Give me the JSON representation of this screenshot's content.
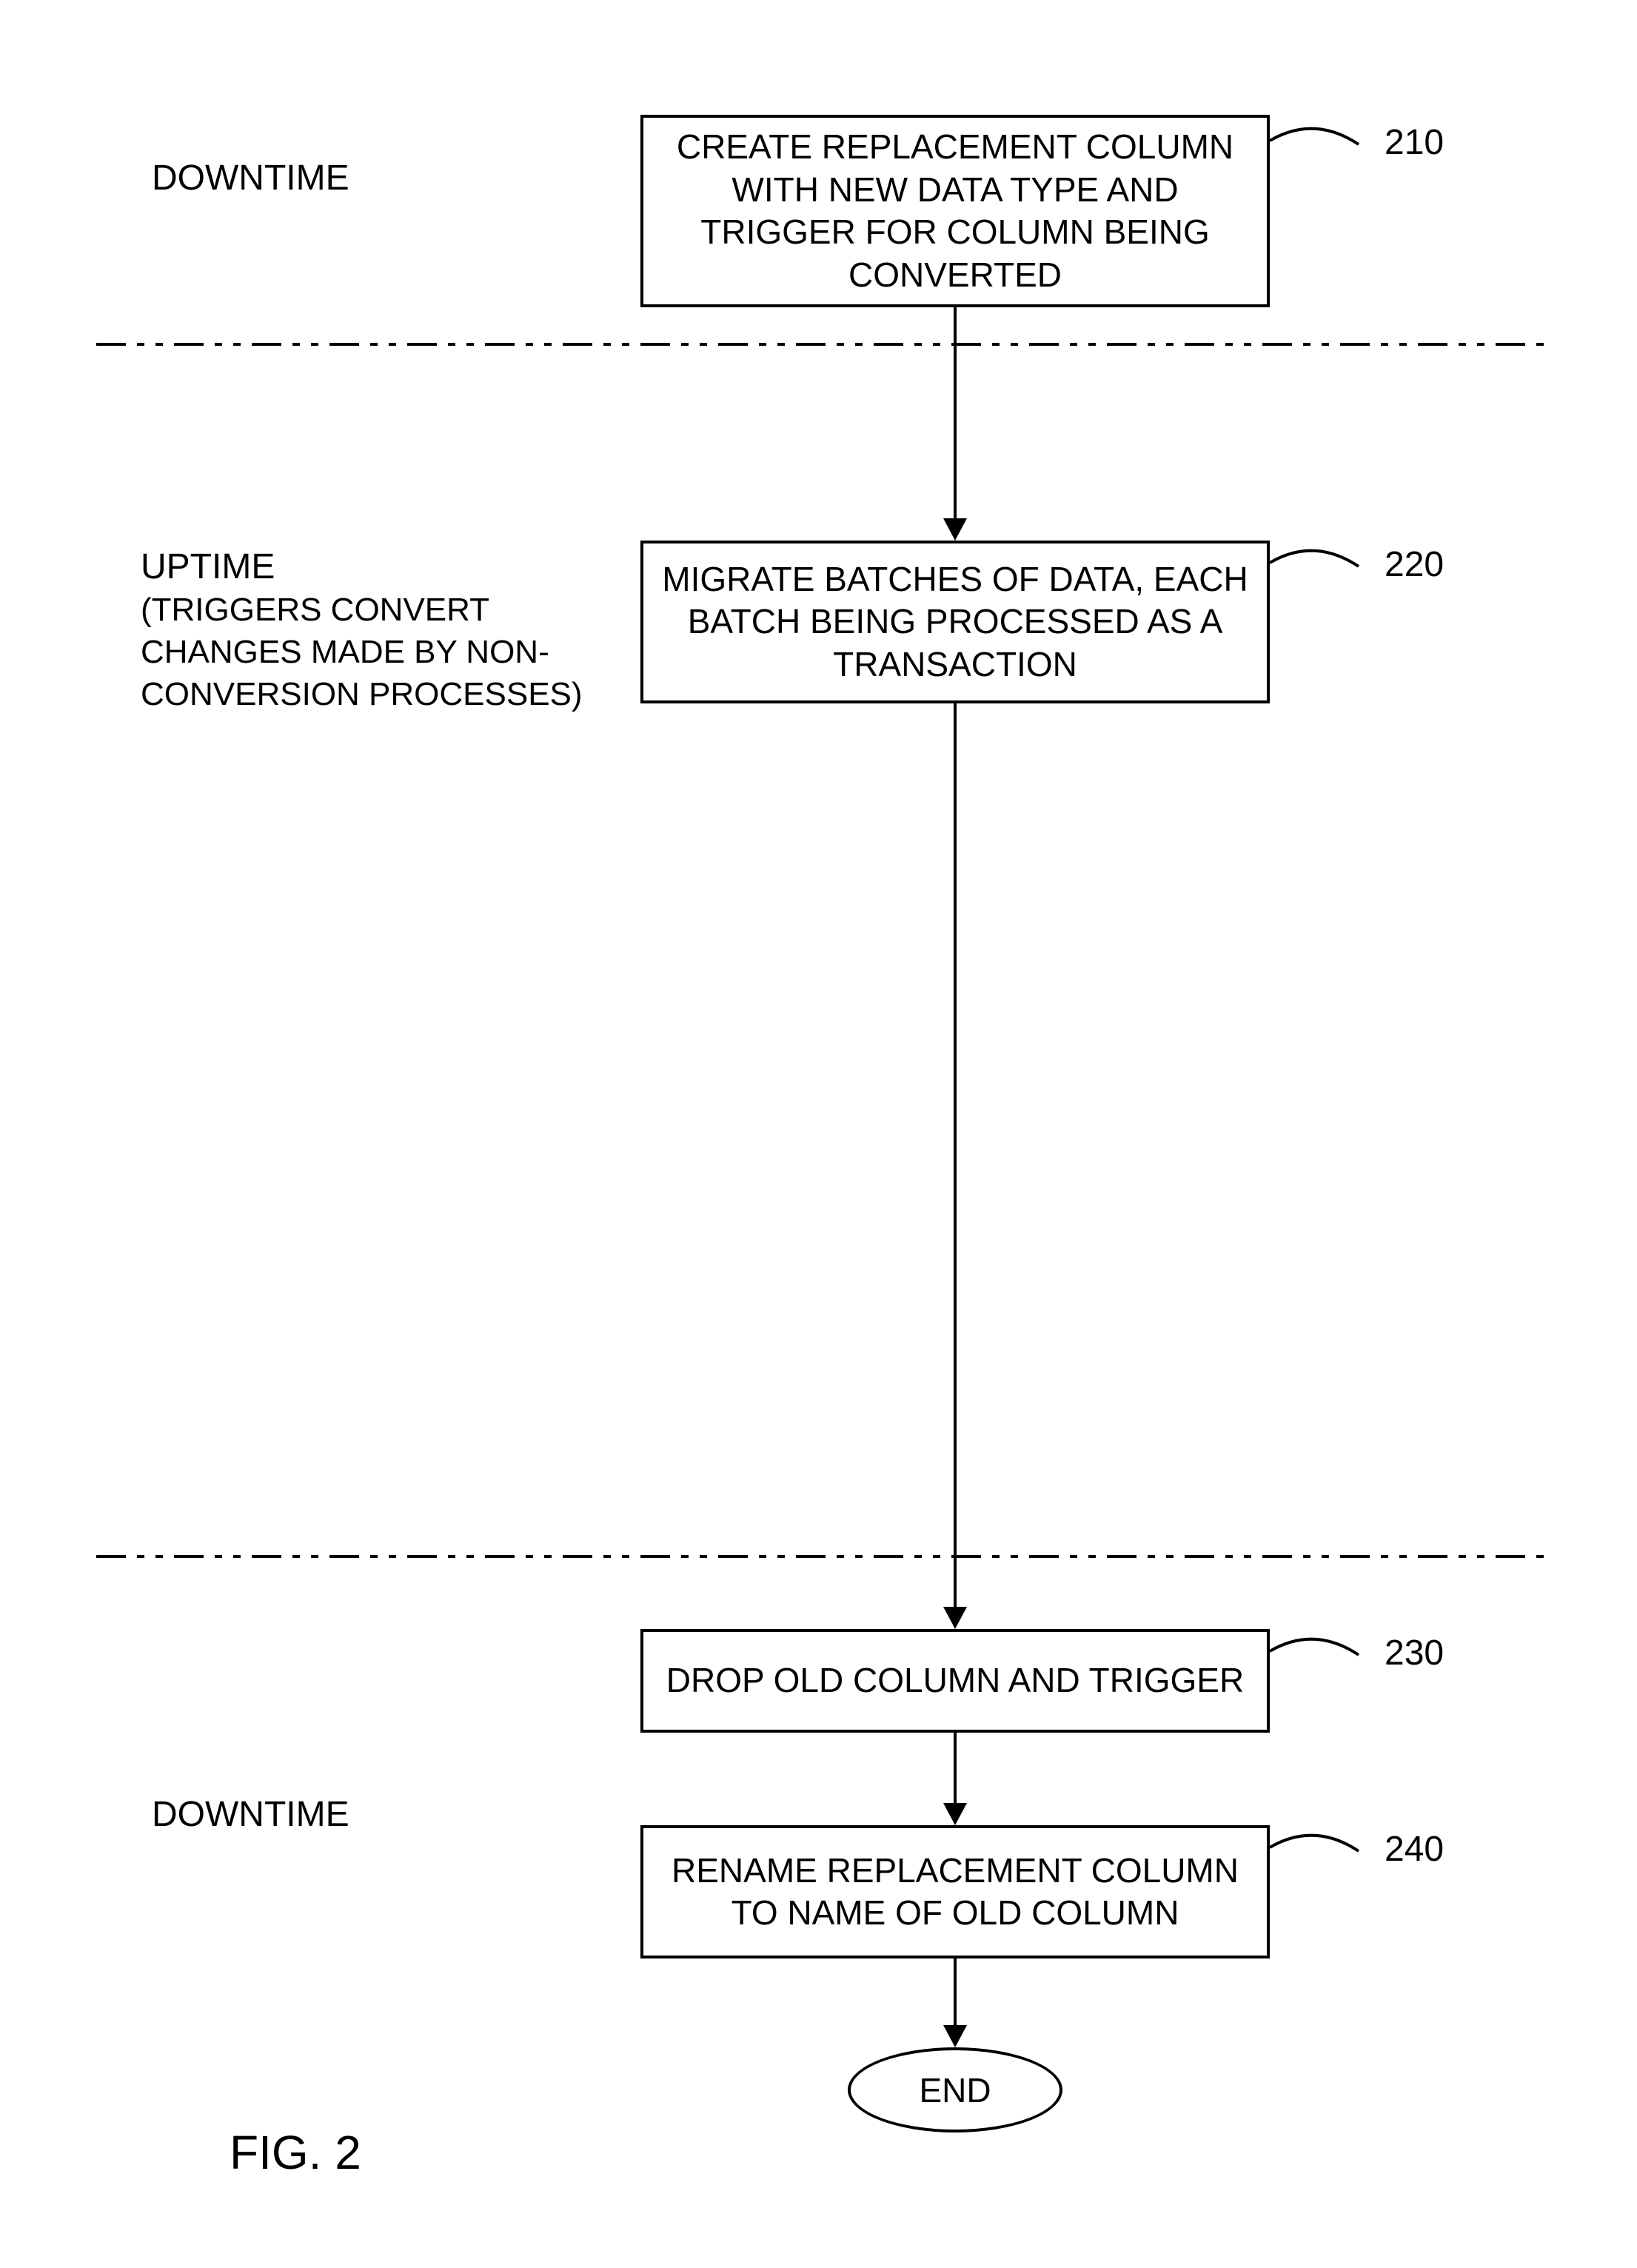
{
  "phase_labels": {
    "downtime_top": "DOWNTIME",
    "uptime": "UPTIME",
    "uptime_detail": "(TRIGGERS CONVERT CHANGES MADE BY NON-CONVERSION PROCESSES)",
    "downtime_bottom": "DOWNTIME"
  },
  "steps": {
    "s210": {
      "text": "CREATE REPLACEMENT COLUMN WITH NEW DATA TYPE AND TRIGGER FOR COLUMN BEING CONVERTED",
      "ref": "210"
    },
    "s220": {
      "text": "MIGRATE BATCHES OF DATA, EACH BATCH BEING PROCESSED AS A TRANSACTION",
      "ref": "220"
    },
    "s230": {
      "text": "DROP OLD COLUMN AND TRIGGER",
      "ref": "230"
    },
    "s240": {
      "text": "RENAME REPLACEMENT COLUMN TO NAME OF OLD COLUMN",
      "ref": "240"
    }
  },
  "end_label": "END",
  "figure_label": "FIG. 2"
}
